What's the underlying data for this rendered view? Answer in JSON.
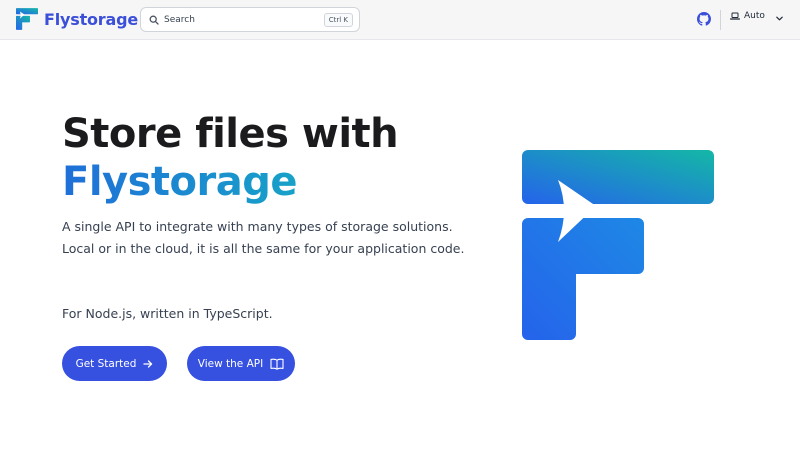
{
  "brand": {
    "name": "Flystorage",
    "icon": "flystorage-logo-icon"
  },
  "search": {
    "placeholder": "Search",
    "shortcut": "Ctrl K",
    "icon": "search-icon"
  },
  "header": {
    "github_icon": "github-icon",
    "theme_label": "Auto",
    "theme_icon": "laptop-icon",
    "dropdown_icon": "chevron-down-icon"
  },
  "hero": {
    "title_line1": "Store files with",
    "title_line2": "Flystorage",
    "description": "A single API to integrate with many types of storage solutions. Local or in the cloud, it is all the same for your application code.",
    "subtext": "For Node.js, written in TypeScript.",
    "primary_button": "Get Started",
    "secondary_button": "View the API",
    "primary_icon": "arrow-right-icon",
    "secondary_icon": "book-icon"
  },
  "colors": {
    "accent": "#3650e0",
    "brand_text": "#3b4fd8",
    "gradient_start": "#2563eb",
    "gradient_end": "#14b8a6",
    "heading": "#1b1b1d"
  }
}
